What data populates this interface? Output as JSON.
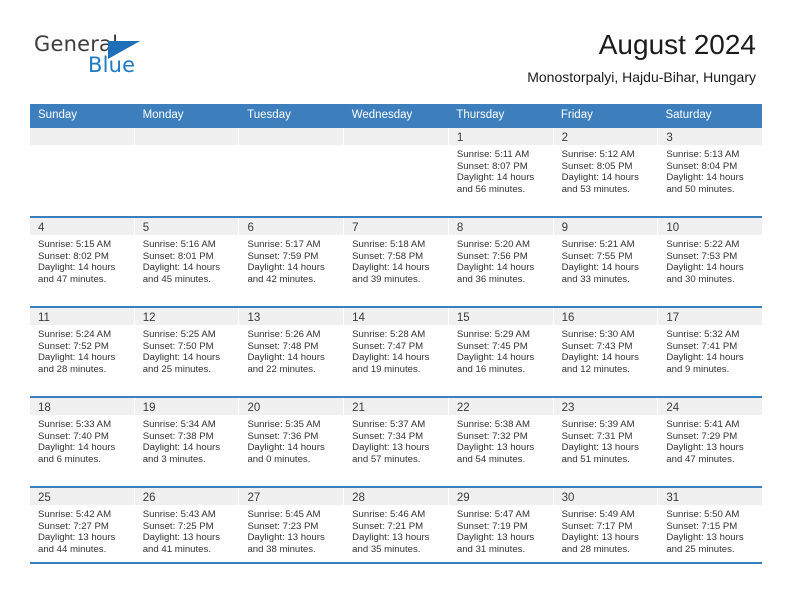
{
  "brand": {
    "name_part1": "General",
    "name_part2": "Blue",
    "logo_icon": "triangle-flag-icon",
    "color_primary": "#1d6fb8",
    "color_dark": "#3c3c3c"
  },
  "header": {
    "title": "August 2024",
    "location": "Monostorpalyi, Hajdu-Bihar, Hungary"
  },
  "theme": {
    "header_blue": "#3d7ebd",
    "band_gray": "#f0f0f0",
    "text_dark": "#333333"
  },
  "weekdays": [
    "Sunday",
    "Monday",
    "Tuesday",
    "Wednesday",
    "Thursday",
    "Friday",
    "Saturday"
  ],
  "weeks": [
    [
      {
        "day": "",
        "sunrise": "",
        "sunset": "",
        "daylight_line1": "",
        "daylight_line2": ""
      },
      {
        "day": "",
        "sunrise": "",
        "sunset": "",
        "daylight_line1": "",
        "daylight_line2": ""
      },
      {
        "day": "",
        "sunrise": "",
        "sunset": "",
        "daylight_line1": "",
        "daylight_line2": ""
      },
      {
        "day": "",
        "sunrise": "",
        "sunset": "",
        "daylight_line1": "",
        "daylight_line2": ""
      },
      {
        "day": "1",
        "sunrise": "Sunrise: 5:11 AM",
        "sunset": "Sunset: 8:07 PM",
        "daylight_line1": "Daylight: 14 hours",
        "daylight_line2": "and 56 minutes."
      },
      {
        "day": "2",
        "sunrise": "Sunrise: 5:12 AM",
        "sunset": "Sunset: 8:05 PM",
        "daylight_line1": "Daylight: 14 hours",
        "daylight_line2": "and 53 minutes."
      },
      {
        "day": "3",
        "sunrise": "Sunrise: 5:13 AM",
        "sunset": "Sunset: 8:04 PM",
        "daylight_line1": "Daylight: 14 hours",
        "daylight_line2": "and 50 minutes."
      }
    ],
    [
      {
        "day": "4",
        "sunrise": "Sunrise: 5:15 AM",
        "sunset": "Sunset: 8:02 PM",
        "daylight_line1": "Daylight: 14 hours",
        "daylight_line2": "and 47 minutes."
      },
      {
        "day": "5",
        "sunrise": "Sunrise: 5:16 AM",
        "sunset": "Sunset: 8:01 PM",
        "daylight_line1": "Daylight: 14 hours",
        "daylight_line2": "and 45 minutes."
      },
      {
        "day": "6",
        "sunrise": "Sunrise: 5:17 AM",
        "sunset": "Sunset: 7:59 PM",
        "daylight_line1": "Daylight: 14 hours",
        "daylight_line2": "and 42 minutes."
      },
      {
        "day": "7",
        "sunrise": "Sunrise: 5:18 AM",
        "sunset": "Sunset: 7:58 PM",
        "daylight_line1": "Daylight: 14 hours",
        "daylight_line2": "and 39 minutes."
      },
      {
        "day": "8",
        "sunrise": "Sunrise: 5:20 AM",
        "sunset": "Sunset: 7:56 PM",
        "daylight_line1": "Daylight: 14 hours",
        "daylight_line2": "and 36 minutes."
      },
      {
        "day": "9",
        "sunrise": "Sunrise: 5:21 AM",
        "sunset": "Sunset: 7:55 PM",
        "daylight_line1": "Daylight: 14 hours",
        "daylight_line2": "and 33 minutes."
      },
      {
        "day": "10",
        "sunrise": "Sunrise: 5:22 AM",
        "sunset": "Sunset: 7:53 PM",
        "daylight_line1": "Daylight: 14 hours",
        "daylight_line2": "and 30 minutes."
      }
    ],
    [
      {
        "day": "11",
        "sunrise": "Sunrise: 5:24 AM",
        "sunset": "Sunset: 7:52 PM",
        "daylight_line1": "Daylight: 14 hours",
        "daylight_line2": "and 28 minutes."
      },
      {
        "day": "12",
        "sunrise": "Sunrise: 5:25 AM",
        "sunset": "Sunset: 7:50 PM",
        "daylight_line1": "Daylight: 14 hours",
        "daylight_line2": "and 25 minutes."
      },
      {
        "day": "13",
        "sunrise": "Sunrise: 5:26 AM",
        "sunset": "Sunset: 7:48 PM",
        "daylight_line1": "Daylight: 14 hours",
        "daylight_line2": "and 22 minutes."
      },
      {
        "day": "14",
        "sunrise": "Sunrise: 5:28 AM",
        "sunset": "Sunset: 7:47 PM",
        "daylight_line1": "Daylight: 14 hours",
        "daylight_line2": "and 19 minutes."
      },
      {
        "day": "15",
        "sunrise": "Sunrise: 5:29 AM",
        "sunset": "Sunset: 7:45 PM",
        "daylight_line1": "Daylight: 14 hours",
        "daylight_line2": "and 16 minutes."
      },
      {
        "day": "16",
        "sunrise": "Sunrise: 5:30 AM",
        "sunset": "Sunset: 7:43 PM",
        "daylight_line1": "Daylight: 14 hours",
        "daylight_line2": "and 12 minutes."
      },
      {
        "day": "17",
        "sunrise": "Sunrise: 5:32 AM",
        "sunset": "Sunset: 7:41 PM",
        "daylight_line1": "Daylight: 14 hours",
        "daylight_line2": "and 9 minutes."
      }
    ],
    [
      {
        "day": "18",
        "sunrise": "Sunrise: 5:33 AM",
        "sunset": "Sunset: 7:40 PM",
        "daylight_line1": "Daylight: 14 hours",
        "daylight_line2": "and 6 minutes."
      },
      {
        "day": "19",
        "sunrise": "Sunrise: 5:34 AM",
        "sunset": "Sunset: 7:38 PM",
        "daylight_line1": "Daylight: 14 hours",
        "daylight_line2": "and 3 minutes."
      },
      {
        "day": "20",
        "sunrise": "Sunrise: 5:35 AM",
        "sunset": "Sunset: 7:36 PM",
        "daylight_line1": "Daylight: 14 hours",
        "daylight_line2": "and 0 minutes."
      },
      {
        "day": "21",
        "sunrise": "Sunrise: 5:37 AM",
        "sunset": "Sunset: 7:34 PM",
        "daylight_line1": "Daylight: 13 hours",
        "daylight_line2": "and 57 minutes."
      },
      {
        "day": "22",
        "sunrise": "Sunrise: 5:38 AM",
        "sunset": "Sunset: 7:32 PM",
        "daylight_line1": "Daylight: 13 hours",
        "daylight_line2": "and 54 minutes."
      },
      {
        "day": "23",
        "sunrise": "Sunrise: 5:39 AM",
        "sunset": "Sunset: 7:31 PM",
        "daylight_line1": "Daylight: 13 hours",
        "daylight_line2": "and 51 minutes."
      },
      {
        "day": "24",
        "sunrise": "Sunrise: 5:41 AM",
        "sunset": "Sunset: 7:29 PM",
        "daylight_line1": "Daylight: 13 hours",
        "daylight_line2": "and 47 minutes."
      }
    ],
    [
      {
        "day": "25",
        "sunrise": "Sunrise: 5:42 AM",
        "sunset": "Sunset: 7:27 PM",
        "daylight_line1": "Daylight: 13 hours",
        "daylight_line2": "and 44 minutes."
      },
      {
        "day": "26",
        "sunrise": "Sunrise: 5:43 AM",
        "sunset": "Sunset: 7:25 PM",
        "daylight_line1": "Daylight: 13 hours",
        "daylight_line2": "and 41 minutes."
      },
      {
        "day": "27",
        "sunrise": "Sunrise: 5:45 AM",
        "sunset": "Sunset: 7:23 PM",
        "daylight_line1": "Daylight: 13 hours",
        "daylight_line2": "and 38 minutes."
      },
      {
        "day": "28",
        "sunrise": "Sunrise: 5:46 AM",
        "sunset": "Sunset: 7:21 PM",
        "daylight_line1": "Daylight: 13 hours",
        "daylight_line2": "and 35 minutes."
      },
      {
        "day": "29",
        "sunrise": "Sunrise: 5:47 AM",
        "sunset": "Sunset: 7:19 PM",
        "daylight_line1": "Daylight: 13 hours",
        "daylight_line2": "and 31 minutes."
      },
      {
        "day": "30",
        "sunrise": "Sunrise: 5:49 AM",
        "sunset": "Sunset: 7:17 PM",
        "daylight_line1": "Daylight: 13 hours",
        "daylight_line2": "and 28 minutes."
      },
      {
        "day": "31",
        "sunrise": "Sunrise: 5:50 AM",
        "sunset": "Sunset: 7:15 PM",
        "daylight_line1": "Daylight: 13 hours",
        "daylight_line2": "and 25 minutes."
      }
    ]
  ]
}
